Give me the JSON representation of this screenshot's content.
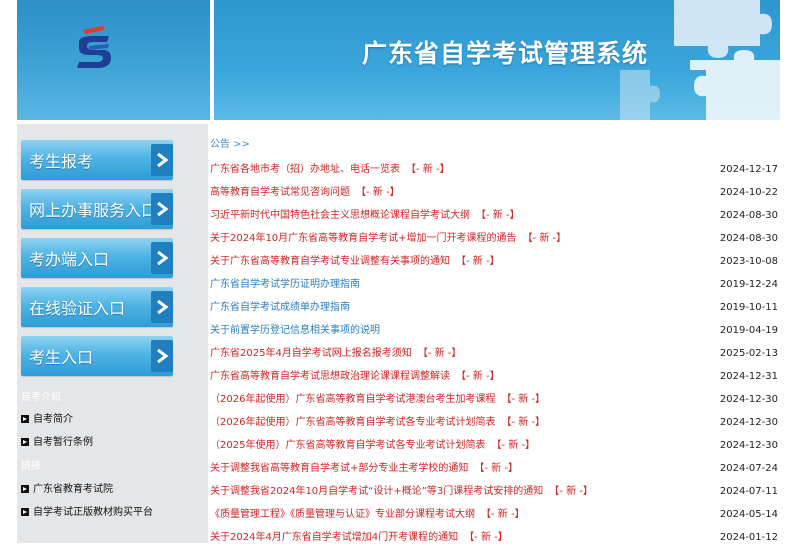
{
  "header": {
    "title": "广东省自学考试管理系统"
  },
  "sidebar": {
    "nav_buttons": [
      {
        "label": "考生报考"
      },
      {
        "label": "网上办事服务入口"
      },
      {
        "label": "考办端入口"
      },
      {
        "label": "在线验证入口"
      },
      {
        "label": "考生入口"
      }
    ],
    "section1_title": "自考介绍",
    "section1_links": [
      {
        "label": "自考简介"
      },
      {
        "label": "自考暂行条例"
      }
    ],
    "section2_title": "链接",
    "section2_links": [
      {
        "label": "广东省教育考试院"
      },
      {
        "label": "自学考试正版教材购买平台"
      }
    ]
  },
  "main": {
    "section_title": "公告 >>",
    "badge": "【- 新 -】",
    "items": [
      {
        "title": "广东省各地市考（招）办地址、电话一览表",
        "date": "2024-12-17"
      },
      {
        "title": "高等教育自学考试常见咨询问题",
        "date": "2024-10-22"
      },
      {
        "title": "习近平新时代中国特色社会主义思想概论课程自学考试大纲",
        "date": "2024-08-30"
      },
      {
        "title": "关于2024年10月广东省高等教育自学考试+增加一门开考课程的通告",
        "date": "2024-08-30"
      },
      {
        "title": "关于广东省高等教育自学考试专业调整有关事项的通知",
        "date": "2023-10-08"
      },
      {
        "title": "广东省自学考试学历证明办理指南",
        "date": "2019-12-24"
      },
      {
        "title": "广东省自学考试成绩单办理指南",
        "date": "2019-10-11"
      },
      {
        "title": "关于前置学历登记信息相关事项的说明",
        "date": "2019-04-19"
      },
      {
        "title": "广东省2025年4月自学考试网上报名报考须知",
        "date": "2025-02-13"
      },
      {
        "title": "广东省高等教育自学考试思想政治理论课课程调整解读",
        "date": "2024-12-31"
      },
      {
        "title": "（2026年起使用）广东省高等教育自学考试港澳台考生加考课程",
        "date": "2024-12-30"
      },
      {
        "title": "（2026年起使用）广东省高等教育自学考试各专业考试计划简表",
        "date": "2024-12-30"
      },
      {
        "title": "（2025年使用）广东省高等教育自学考试各专业考试计划简表",
        "date": "2024-12-30"
      },
      {
        "title": "关于调整我省高等教育自学考试+部分专业主考学校的通知",
        "date": "2024-07-24"
      },
      {
        "title": "关于调整我省2024年10月自学考试“设计+概论”等3门课程考试安排的通知",
        "date": "2024-07-11"
      },
      {
        "title": "《质量管理工程》《质量管理与认证》专业部分课程考试大纲",
        "date": "2024-05-14"
      },
      {
        "title": "关于2024年4月广东省自学考试增加4门开考课程的通知",
        "date": "2024-01-12"
      }
    ]
  },
  "colors": {
    "accent_blue": "#3ba6dc",
    "link_red": "#d02525",
    "link_blue": "#2a7fc0",
    "sidebar_bg": "#e4e6e8"
  }
}
